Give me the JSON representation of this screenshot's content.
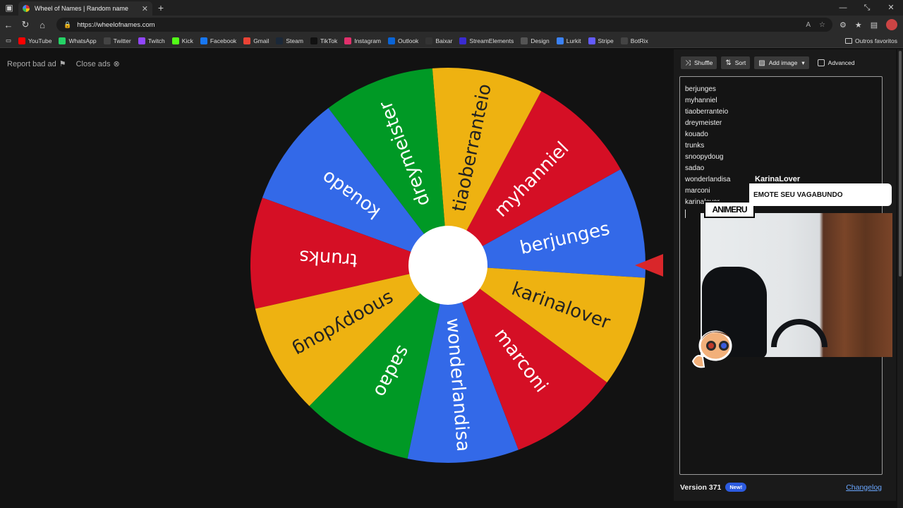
{
  "browser": {
    "tab_title": "Wheel of Names | Random name",
    "url": "https://wheelofnames.com",
    "bookmarks": [
      {
        "label": "YouTube",
        "color": "#ff0000"
      },
      {
        "label": "WhatsApp",
        "color": "#25d366"
      },
      {
        "label": "Twitter",
        "color": "#444444"
      },
      {
        "label": "Twitch",
        "color": "#9146ff"
      },
      {
        "label": "Kick",
        "color": "#53fc18"
      },
      {
        "label": "Facebook",
        "color": "#1877f2"
      },
      {
        "label": "Gmail",
        "color": "#ea4335"
      },
      {
        "label": "Steam",
        "color": "#1b2838"
      },
      {
        "label": "TikTok",
        "color": "#111111"
      },
      {
        "label": "Instagram",
        "color": "#e1306c"
      },
      {
        "label": "Outlook",
        "color": "#0a64d6"
      },
      {
        "label": "Baixar",
        "color": "#333333"
      },
      {
        "label": "StreamElements",
        "color": "#3a2bd1"
      },
      {
        "label": "Design",
        "color": "#555555"
      },
      {
        "label": "Lurkit",
        "color": "#3b82f6"
      },
      {
        "label": "Stripe",
        "color": "#635bff"
      },
      {
        "label": "BotRix",
        "color": "#444444"
      }
    ],
    "other_favorites": "Outros favoritos"
  },
  "ads": {
    "report": "Report bad ad",
    "close": "Close ads"
  },
  "wheel": {
    "colors": [
      "#3369e8",
      "#d50f25",
      "#eeb211",
      "#009925"
    ],
    "segments": [
      {
        "label": "berjunges",
        "color": "#3369e8"
      },
      {
        "label": "myhanniel",
        "color": "#d50f25"
      },
      {
        "label": "tiaoberranteio",
        "color": "#eeb211"
      },
      {
        "label": "dreymeister",
        "color": "#009925"
      },
      {
        "label": "kouado",
        "color": "#3369e8"
      },
      {
        "label": "trunks",
        "color": "#d50f25"
      },
      {
        "label": "snoopydoug",
        "color": "#eeb211"
      },
      {
        "label": "sadao",
        "color": "#009925"
      },
      {
        "label": "wonderlandisa",
        "color": "#3369e8"
      },
      {
        "label": "marconi",
        "color": "#d50f25"
      },
      {
        "label": "karinalover",
        "color": "#eeb211"
      }
    ]
  },
  "panel": {
    "shuffle": "Shuffle",
    "sort": "Sort",
    "add_image": "Add image",
    "advanced": "Advanced",
    "names": [
      "berjunges",
      "myhanniel",
      "tiaoberranteio",
      "dreymeister",
      "kouado",
      "trunks",
      "snoopydoug",
      "sadao",
      "wonderlandisa",
      "marconi",
      "karinalover"
    ],
    "version": "Version 371",
    "new_badge": "New!",
    "changelog": "Changelog"
  },
  "overlay": {
    "chat_user": "KarinaLover",
    "chat_message": "EMOTE SEU VAGABUNDO",
    "cam_label": "ANIMERU"
  }
}
